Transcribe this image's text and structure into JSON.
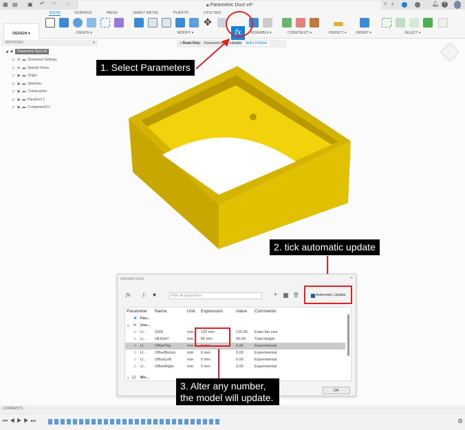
{
  "window": {
    "title": "Parametric Duct v4*"
  },
  "toolbar": {
    "tabs": [
      "SOLID",
      "SURFACE",
      "MESH",
      "SHEET METAL",
      "PLASTIC",
      "UTILITIES"
    ],
    "workspace": "DESIGN ▾",
    "groups": [
      "CREATE ▾",
      "MODIFY ▾",
      "ASSEMBLE ▾",
      "CONSTRUCT ▾",
      "INSPECT ▾",
      "INSERT ▾",
      "SELECT ▾"
    ],
    "fx": "fx"
  },
  "browser": {
    "title": "BROWSER",
    "root": "Parametric Duct v4",
    "items": [
      "Document Settings",
      "Named Views",
      "Origin",
      "Sketches",
      "Construction",
      "ParaDuct 1",
      "Component2:1"
    ]
  },
  "readonly": {
    "label": "Read-Only:",
    "message": "Document is not editable",
    "action": "Make Editable"
  },
  "notes": {
    "step1": "1. Select Parameters",
    "step2": "2. tick automatic update",
    "step3a": "3. Alter any number,",
    "step3b": "the model will update."
  },
  "dialog": {
    "title": "PARAMETERS",
    "filter_placeholder": "Filter all parameters",
    "auto_update": "Automatic Update",
    "ok": "OK",
    "columns": [
      "Parameter",
      "Name",
      "Unit",
      "Expression",
      "Value",
      "Comments"
    ],
    "groups": [
      "Fav...",
      "Use...",
      "Mo..."
    ],
    "rows": [
      {
        "p": "U...",
        "name": "SIZE",
        "unit": "mm",
        "expr": "120 mm",
        "value": "120.00",
        "comment": "Enter fan size"
      },
      {
        "p": "U...",
        "name": "HEIGHT",
        "unit": "mm",
        "expr": "50 mm",
        "value": "50.00",
        "comment": "Total Height"
      },
      {
        "p": "U...",
        "name": "OffsetTop",
        "unit": "mm",
        "expr": "0 mm",
        "value": "0.00",
        "comment": "Experimental"
      },
      {
        "p": "U...",
        "name": "OffsetBotom",
        "unit": "mm",
        "expr": "0 mm",
        "value": "0.00",
        "comment": "Experimental"
      },
      {
        "p": "U...",
        "name": "OffsetLeft",
        "unit": "mm",
        "expr": "0 mm",
        "value": "0.00",
        "comment": "Experimental"
      },
      {
        "p": "U...",
        "name": "OffsetRight",
        "unit": "mm",
        "expr": "0 mm",
        "value": "0.00",
        "comment": "Experimental"
      }
    ]
  },
  "comments": {
    "title": "COMMENTS"
  }
}
